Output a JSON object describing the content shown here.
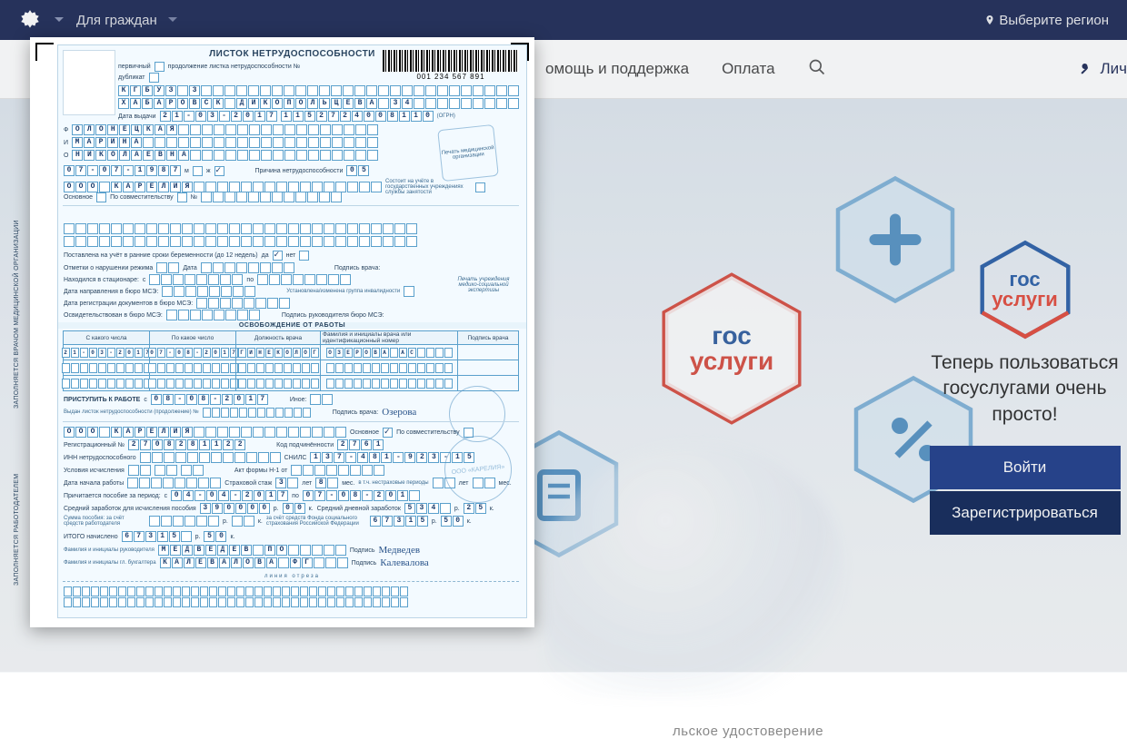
{
  "site": {
    "nav1": {
      "citizens": "Для граждан",
      "region": "Выберите регион"
    },
    "nav2": {
      "help": "омощь и поддержка",
      "pay": "Оплата",
      "login_short": "Лич"
    },
    "promo": {
      "brand_line1": "гос",
      "brand_line2": "услуги",
      "headline": "Теперь пользоваться госуслугами очень просто!",
      "login": "Войти",
      "register": "Зарегистрироваться"
    },
    "caption_under": "льское удостоверение"
  },
  "form": {
    "title": "ЛИСТОК НЕТРУДОСПОСОБНОСТИ",
    "barcode_number": "001 234 567 891",
    "flags": {
      "primary_label": "первичный",
      "duplicate_label": "дубликат",
      "cont_label": "продолжение листка нетрудоспособности №"
    },
    "org_name": "КГБУЗ 3",
    "address": "ХАБАРОВСК ДИКОПОЛЬЦЕВА 34",
    "issue_label": "Дата выдачи",
    "issue_date": "21-03-2017",
    "ogrn_label": "(ОГРН)",
    "ogrn": "1152724008110",
    "patient_surname": "ОЛОНЕЦКАЯ",
    "patient_name": "МАРИНА",
    "patient_patr": "НИКОЛАЕВНА",
    "name_prefix": {
      "f": "Ф",
      "i": "И",
      "o": "О"
    },
    "dob": "07-07-1987",
    "sex_m_label": "м",
    "sex_f_label": "ж",
    "reason_label": "Причина нетрудоспособности",
    "reason_code": "05",
    "employer": "ООО КАРЕЛИЯ",
    "main_label": "Основное",
    "part_label": "По совместительству",
    "no_label": "№",
    "registered_text": "Состоит на учёте в государственных учреждениях службы занятости",
    "preg_label": "Поставлена на учёт в ранние сроки беременности (до 12 недель)",
    "yes": "да",
    "no": "нет",
    "violation_label": "Отметки о нарушении режима",
    "date_label": "Дата",
    "doc_sign_label": "Подпись врача:",
    "hospital_label": "Находился в стационаре:",
    "from": "с",
    "to": "по",
    "mse1": "Дата направления в бюро МСЭ:",
    "mse2": "Дата регистрации документов в бюро МСЭ:",
    "mse3": "Освидетельствован в бюро МСЭ:",
    "disability_label": "Установлена/изменена группа инвалидности",
    "mse_sign": "Подпись руководителя бюро МСЭ:",
    "mse_stamp": "Печать учреждения медико-социальной экспертизы",
    "release_title": "ОСВОБОЖДЕНИЕ ОТ РАБОТЫ",
    "tbl_headers": [
      "С какого числа",
      "По какое число",
      "Должность врача",
      "Фамилия и инициалы врача или идентификационный номер",
      "Подпись врача"
    ],
    "tbl_row": {
      "from": "21-03-2017",
      "to": "07-08-2017",
      "role": "ГИНЕКОЛОГ",
      "doctor": "ОЗЕРОВА АС"
    },
    "start_work_label": "ПРИСТУПИТЬ К РАБОТЕ",
    "start_work_date": "08-08-2017",
    "other_label": "Иное:",
    "issued_new_label": "Выдан листок нетрудоспособности (продолжение) №",
    "sign_doc": "Озерова",
    "employer2": "ООО КАРЕЛИЯ",
    "reg_no_label": "Регистрационный №",
    "reg_no": "2708281122",
    "sub_code_label": "Код подчинённости",
    "sub_code": "2761",
    "inn_label": "ИНН нетрудоспособного",
    "snils_label": "СНИЛС",
    "snils": "137-481-923-15",
    "act_label": "Акт формы Н-1 от",
    "conditions_label": "Условия исчисления",
    "start_date_label": "Дата начала работы",
    "stazh_label": "Страховой стаж",
    "stazh_y": "3",
    "stazh_m": "8",
    "y_label": "лет",
    "m_label": "мес.",
    "nonins_label": "в т.ч. нестраховые периоды",
    "benefit_period_label": "Причитается пособие за период:",
    "benefit_from": "04-04-2017",
    "benefit_to": "07-08-201",
    "avg_label": "Средний заработок для исчисления пособия",
    "avg": "390000",
    "avg_k": "00",
    "avgday_label": "Средний дневной заработок",
    "avgday": "534",
    "avgday_k": "25",
    "rub": "р.",
    "kop": "к.",
    "emp_sum_label": "Сумма пособия: за счёт средств работодателя",
    "fss_sum_label": "за счёт средств Фонда социального страхования Российской Федерации",
    "sum1": "67315",
    "sum1k": "50",
    "sum2": "67315",
    "sum2k": "50",
    "total_label": "ИТОГО начислено",
    "head_label": "Фамилия и инициалы руководителя",
    "head": "МЕДВЕДЕВ ПО",
    "head_sig": "Медведев",
    "acc_label": "Фамилия и инициалы гл. бухгалтера",
    "acc": "КАЛЕВАЛОВА ФГ",
    "acc_sig": "Калевалова",
    "sign_label": "Подпись",
    "cut_line": "линия отреза",
    "vlabel_med": "ЗАПОЛНЯЕТСЯ ВРАЧОМ МЕДИЦИНСКОЙ ОРГАНИЗАЦИИ",
    "vlabel_emp": "ЗАПОЛНЯЕТСЯ РАБОТОДАТЕЛЕМ",
    "karelia_stamp": "ООО «КАРЕЛИЯ»",
    "med_stamp": "Печать медицинской организации"
  }
}
